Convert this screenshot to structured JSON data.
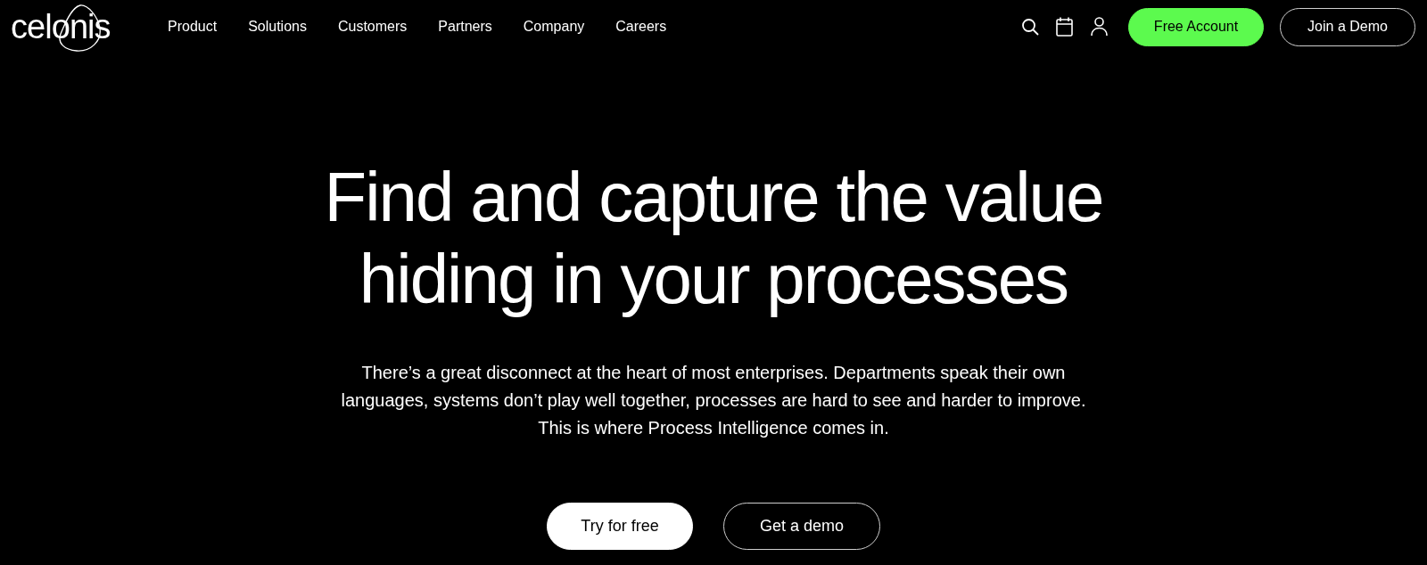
{
  "logo": "celonis",
  "nav": [
    "Product",
    "Solutions",
    "Customers",
    "Partners",
    "Company",
    "Careers"
  ],
  "header_buttons": [
    {
      "label": "Free Account",
      "kind": "primary"
    },
    {
      "label": "Join a Demo",
      "kind": "outline"
    }
  ],
  "hero": {
    "title": [
      "Find and capture the value",
      "hiding in your processes"
    ],
    "text": [
      "There’s a great disconnect at the heart of most enterprises. Departments speak their own",
      "languages, systems don’t play well together, processes are hard to see and harder to improve.",
      "This is where Process Intelligence comes in."
    ],
    "buttons": [
      {
        "label": "Try for free",
        "kind": "solid"
      },
      {
        "label": "Get a demo",
        "kind": "outline"
      }
    ]
  }
}
